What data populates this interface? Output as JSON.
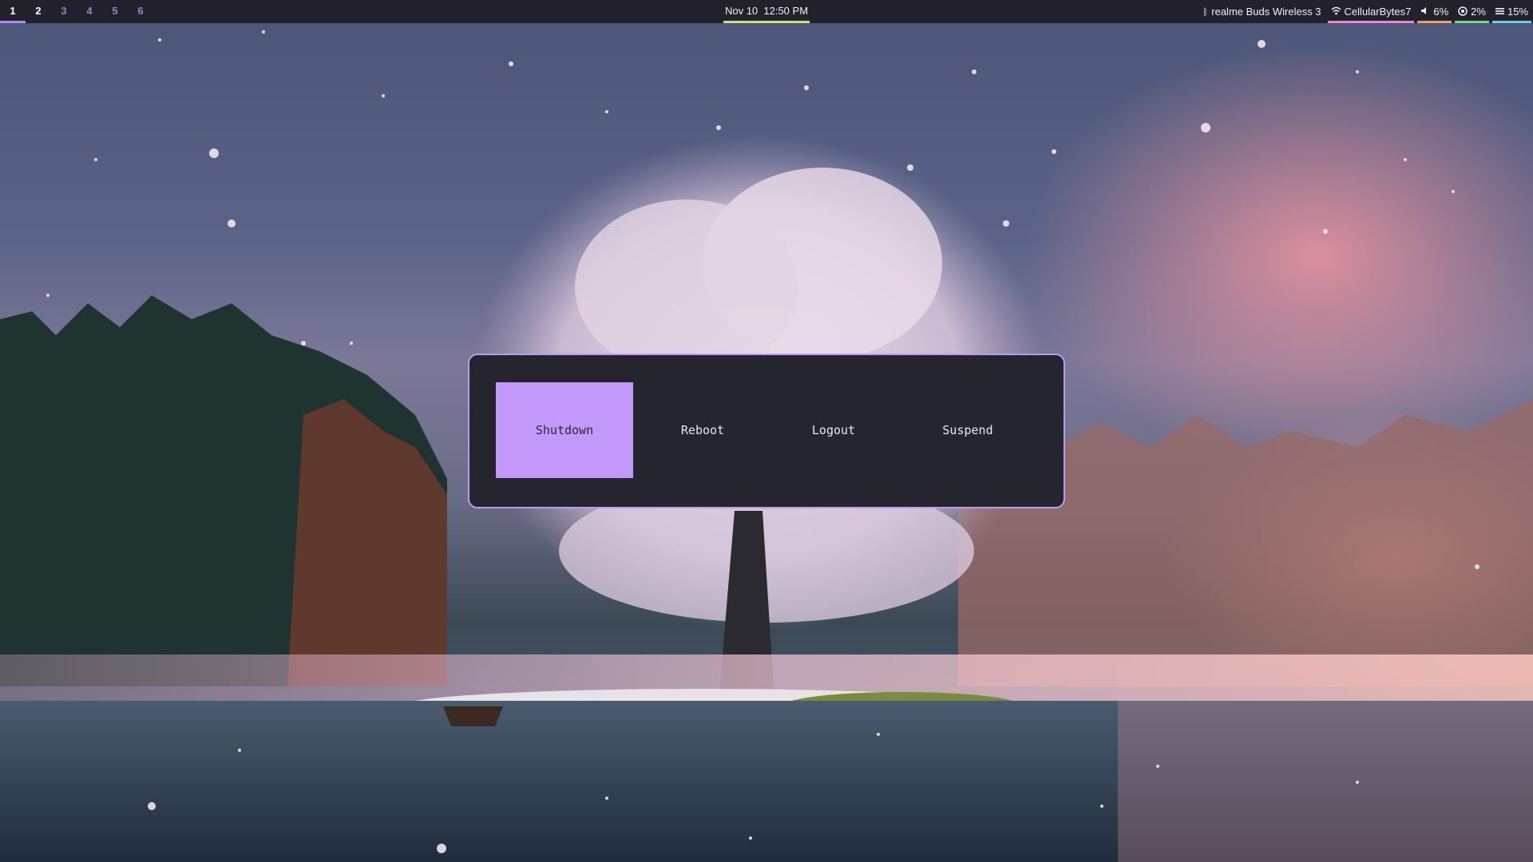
{
  "workspaces": [
    {
      "label": "1",
      "state": "active"
    },
    {
      "label": "2",
      "state": "occupied"
    },
    {
      "label": "3",
      "state": "empty"
    },
    {
      "label": "4",
      "state": "empty"
    },
    {
      "label": "5",
      "state": "empty"
    },
    {
      "label": "6",
      "state": "empty"
    }
  ],
  "clock": {
    "text": "Nov 10  12:50 PM"
  },
  "status": {
    "bluetooth": {
      "icon": "bluetooth-icon",
      "text": "realme Buds Wireless 3"
    },
    "wifi": {
      "icon": "wifi-icon",
      "text": "CellularBytes7"
    },
    "volume": {
      "icon": "speaker-icon",
      "text": "6%"
    },
    "cpu": {
      "icon": "cpu-icon",
      "text": "2%"
    },
    "memory": {
      "icon": "memory-icon",
      "text": "15%"
    }
  },
  "power_menu": {
    "options": [
      {
        "label": "Shutdown",
        "selected": true
      },
      {
        "label": "Reboot",
        "selected": false
      },
      {
        "label": "Logout",
        "selected": false
      },
      {
        "label": "Suspend",
        "selected": false
      }
    ]
  },
  "colors": {
    "bar_bg": "#22212c",
    "accent": "#c299fa",
    "menu_bg": "#252530",
    "menu_border": "#b99cf0",
    "clock_underline": "#c9e08a"
  }
}
